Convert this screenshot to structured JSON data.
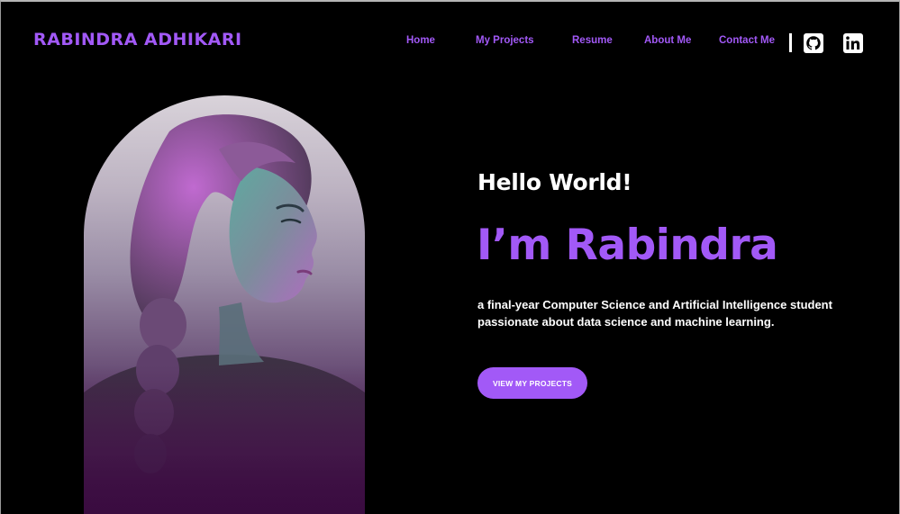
{
  "brand": {
    "name": "RABINDRA ADHIKARI"
  },
  "nav": {
    "items": [
      {
        "label": "Home"
      },
      {
        "label": "My Projects"
      },
      {
        "label": "Resume"
      },
      {
        "label": "About Me"
      },
      {
        "label": "Contact Me"
      }
    ],
    "social": [
      {
        "icon": "github-icon"
      },
      {
        "icon": "linkedin-icon"
      }
    ]
  },
  "hero": {
    "greeting": "Hello World!",
    "headline": "I’m Rabindra",
    "bio": "a final-year Computer Science and Artificial Intelligence student passionate about data science and machine learning.",
    "cta_label": "VIEW MY PROJECTS"
  },
  "colors": {
    "accent": "#a259f7",
    "background": "#000000",
    "text": "#ffffff"
  }
}
